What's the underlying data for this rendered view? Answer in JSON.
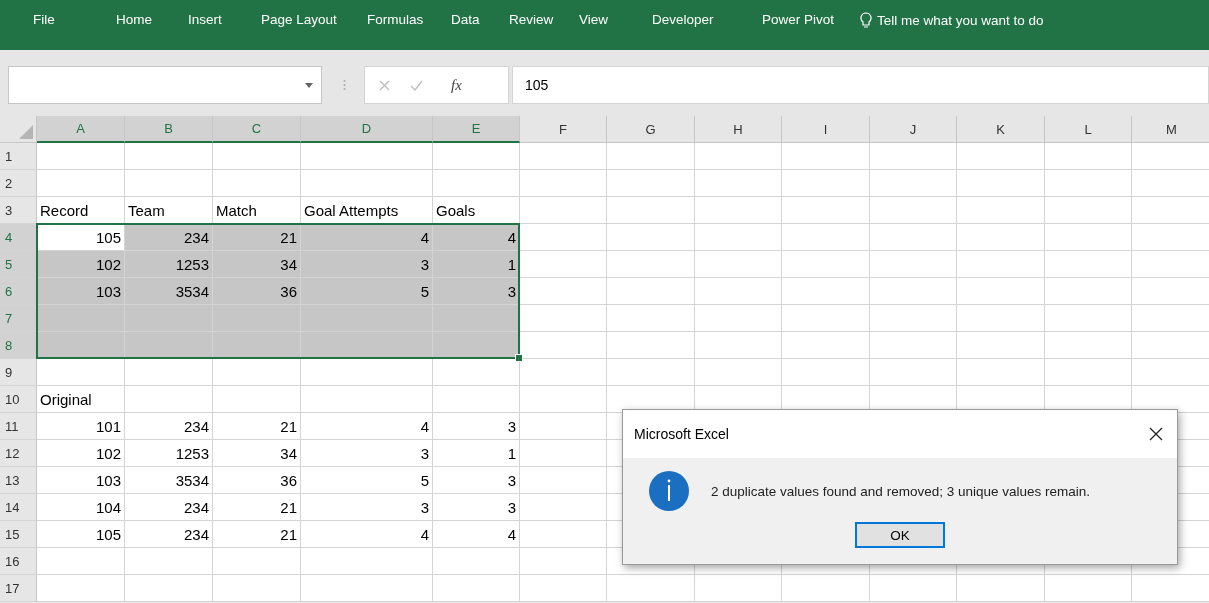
{
  "ribbon": {
    "tabs": [
      "File",
      "Home",
      "Insert",
      "Page Layout",
      "Formulas",
      "Data",
      "Review",
      "View",
      "Developer",
      "Power Pivot"
    ],
    "tell_me": "Tell me what you want to do"
  },
  "formula_bar": {
    "fx": "fx",
    "value": "105"
  },
  "columns": [
    {
      "label": "A",
      "selected": true
    },
    {
      "label": "B",
      "selected": true
    },
    {
      "label": "C",
      "selected": true
    },
    {
      "label": "D",
      "selected": true
    },
    {
      "label": "E",
      "selected": true
    },
    {
      "label": "F",
      "selected": false
    },
    {
      "label": "G",
      "selected": false
    },
    {
      "label": "H",
      "selected": false
    },
    {
      "label": "I",
      "selected": false
    },
    {
      "label": "J",
      "selected": false
    },
    {
      "label": "K",
      "selected": false
    },
    {
      "label": "L",
      "selected": false
    },
    {
      "label": "M",
      "selected": false
    }
  ],
  "rows": [
    {
      "label": "1",
      "selected": false
    },
    {
      "label": "2",
      "selected": false
    },
    {
      "label": "3",
      "selected": false,
      "kind": "labels",
      "cells": [
        {
          "text": "Record"
        },
        {
          "text": "Team"
        },
        {
          "text": "Match"
        },
        {
          "text": "Goal Attempts"
        },
        {
          "text": "Goals"
        }
      ]
    },
    {
      "label": "4",
      "selected": true,
      "kind": "numbers",
      "cells": [
        {
          "text": "105",
          "active": true
        },
        {
          "text": "234",
          "active": false
        },
        {
          "text": "21",
          "active": false
        },
        {
          "text": "4",
          "active": false
        },
        {
          "text": "4",
          "active": false
        }
      ]
    },
    {
      "label": "5",
      "selected": true,
      "kind": "numbers",
      "cells": [
        {
          "text": "102",
          "active": false
        },
        {
          "text": "1253",
          "active": false
        },
        {
          "text": "34",
          "active": false
        },
        {
          "text": "3",
          "active": false
        },
        {
          "text": "1",
          "active": false
        }
      ]
    },
    {
      "label": "6",
      "selected": true,
      "kind": "numbers",
      "cells": [
        {
          "text": "103",
          "active": false
        },
        {
          "text": "3534",
          "active": false
        },
        {
          "text": "36",
          "active": false
        },
        {
          "text": "5",
          "active": false
        },
        {
          "text": "3",
          "active": false
        }
      ]
    },
    {
      "label": "7",
      "selected": true
    },
    {
      "label": "8",
      "selected": true
    },
    {
      "label": "9",
      "selected": false
    },
    {
      "label": "10",
      "selected": false,
      "kind": "labels",
      "cells": [
        {
          "text": "Original"
        }
      ]
    },
    {
      "label": "11",
      "selected": false,
      "kind": "numbers",
      "cells": [
        {
          "text": "101"
        },
        {
          "text": "234"
        },
        {
          "text": "21"
        },
        {
          "text": "4"
        },
        {
          "text": "3"
        }
      ]
    },
    {
      "label": "12",
      "selected": false,
      "kind": "numbers",
      "cells": [
        {
          "text": "102"
        },
        {
          "text": "1253"
        },
        {
          "text": "34"
        },
        {
          "text": "3"
        },
        {
          "text": "1"
        }
      ]
    },
    {
      "label": "13",
      "selected": false,
      "kind": "numbers",
      "cells": [
        {
          "text": "103"
        },
        {
          "text": "3534"
        },
        {
          "text": "36"
        },
        {
          "text": "5"
        },
        {
          "text": "3"
        }
      ]
    },
    {
      "label": "14",
      "selected": false,
      "kind": "numbers",
      "cells": [
        {
          "text": "104"
        },
        {
          "text": "234"
        },
        {
          "text": "21"
        },
        {
          "text": "3"
        },
        {
          "text": "3"
        }
      ]
    },
    {
      "label": "15",
      "selected": false,
      "kind": "numbers",
      "cells": [
        {
          "text": "105"
        },
        {
          "text": "234"
        },
        {
          "text": "21"
        },
        {
          "text": "4"
        },
        {
          "text": "4"
        }
      ]
    },
    {
      "label": "16",
      "selected": false
    },
    {
      "label": "17",
      "selected": false
    }
  ],
  "dialog": {
    "title": "Microsoft Excel",
    "message": "2 duplicate values found and removed; 3 unique values remain.",
    "button": "OK"
  }
}
